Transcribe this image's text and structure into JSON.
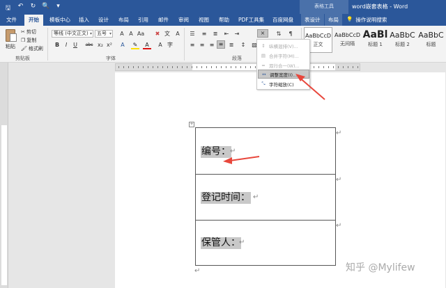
{
  "titlebar": {
    "quick_access": [
      "save-icon",
      "undo-icon",
      "redo-icon",
      "print-preview-icon",
      "customize-icon"
    ],
    "context_tab": "表格工具",
    "window_title": "word嵌套表格 - Word"
  },
  "tabs": {
    "items": [
      "文件",
      "开始",
      "模板中心",
      "插入",
      "设计",
      "布局",
      "引用",
      "邮件",
      "审阅",
      "视图",
      "帮助",
      "PDF工具集",
      "百度网盘",
      "表设计",
      "布局"
    ],
    "active": "开始",
    "tell_me": "操作说明搜索"
  },
  "ribbon": {
    "clipboard": {
      "paste": "粘贴",
      "cut": "剪切",
      "copy": "复制",
      "format_painter": "格式刷",
      "label": "剪贴板"
    },
    "font": {
      "font_name": "等线 (中文正文)",
      "font_size": "五号",
      "label": "字体",
      "buttons": [
        "B",
        "I",
        "U",
        "abc",
        "x₂",
        "x²"
      ]
    },
    "paragraph": {
      "label": "段落"
    },
    "styles": [
      {
        "sample": "AaBbCcD",
        "name": "正文"
      },
      {
        "sample": "AaBbCcD",
        "name": "无间隔"
      },
      {
        "sample": "AaBl",
        "name": "标题 1"
      },
      {
        "sample": "AaBbC",
        "name": "标题 2"
      },
      {
        "sample": "AaBbC",
        "name": "标题"
      }
    ]
  },
  "dropdown_menu": {
    "items": [
      {
        "icon": "纵横混排-icon",
        "label": "纵横混排(V)...",
        "enabled": false
      },
      {
        "icon": "合并字符-icon",
        "label": "合并字符(M)...",
        "enabled": false
      },
      {
        "icon": "双行合一-icon",
        "label": "双行合一(W)...",
        "enabled": false
      },
      {
        "icon": "adjust-width-icon",
        "label": "调整宽度(I)...",
        "enabled": true
      },
      {
        "icon": "char-scale-icon",
        "label": "字符缩放(C)",
        "enabled": true
      }
    ]
  },
  "document": {
    "table_rows": [
      {
        "label": "编号："
      },
      {
        "label": "登记时间："
      },
      {
        "label": "保管人："
      }
    ],
    "paragraph_mark": "↵"
  },
  "watermark": "知乎 @Mylifew",
  "colors": {
    "word_blue": "#2b579a",
    "arrow_red": "#e8473c"
  }
}
